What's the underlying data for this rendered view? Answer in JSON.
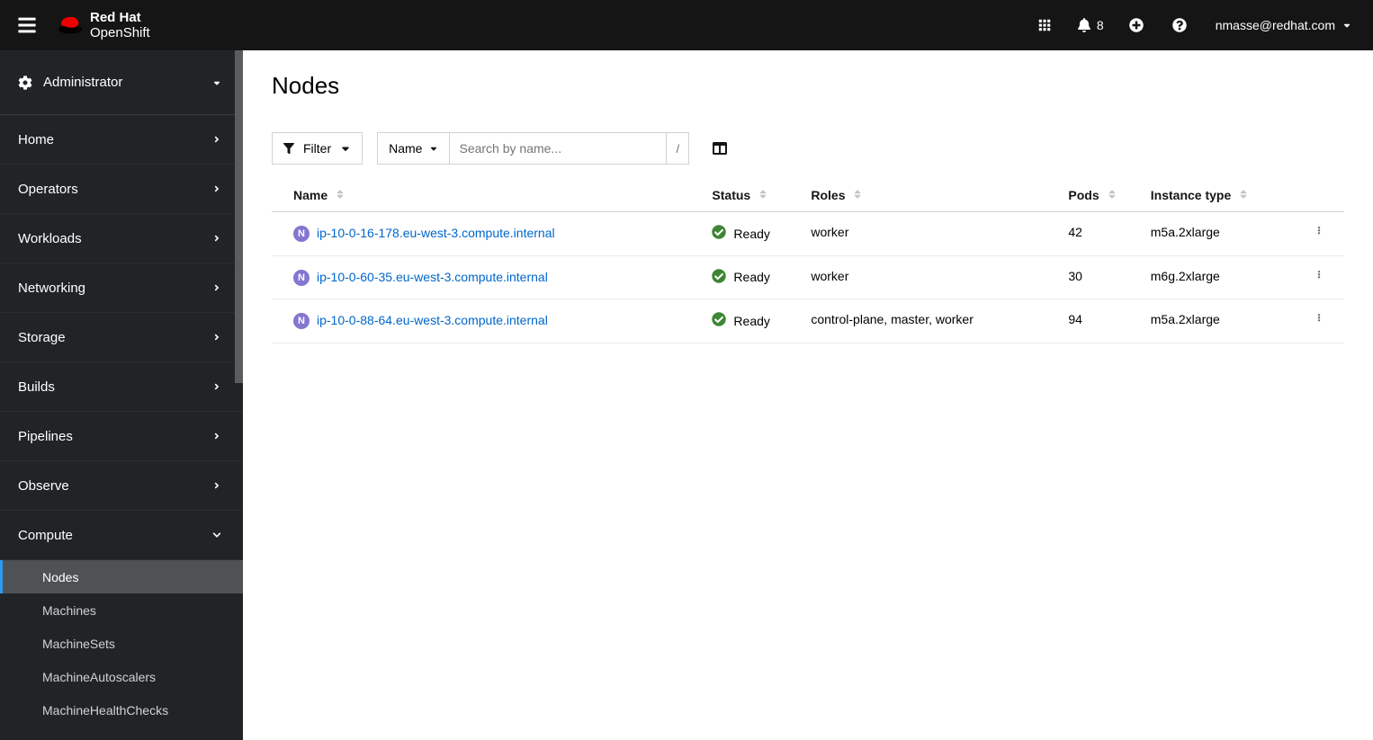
{
  "header": {
    "brand_line1": "Red Hat",
    "brand_line2": "OpenShift",
    "notification_count": "8",
    "user": "nmasse@redhat.com"
  },
  "sidebar": {
    "perspective": "Administrator",
    "items": [
      {
        "label": "Home",
        "expanded": false
      },
      {
        "label": "Operators",
        "expanded": false
      },
      {
        "label": "Workloads",
        "expanded": false
      },
      {
        "label": "Networking",
        "expanded": false
      },
      {
        "label": "Storage",
        "expanded": false
      },
      {
        "label": "Builds",
        "expanded": false
      },
      {
        "label": "Pipelines",
        "expanded": false
      },
      {
        "label": "Observe",
        "expanded": false
      },
      {
        "label": "Compute",
        "expanded": true,
        "subitems": [
          {
            "label": "Nodes",
            "active": true
          },
          {
            "label": "Machines",
            "active": false
          },
          {
            "label": "MachineSets",
            "active": false
          },
          {
            "label": "MachineAutoscalers",
            "active": false
          },
          {
            "label": "MachineHealthChecks",
            "active": false
          }
        ]
      }
    ]
  },
  "main": {
    "title": "Nodes",
    "filter_label": "Filter",
    "search_type": "Name",
    "search_placeholder": "Search by name...",
    "search_hint": "/",
    "columns": [
      "Name",
      "Status",
      "Roles",
      "Pods",
      "Instance type"
    ],
    "status_ready_label": "Ready",
    "node_badge": "N",
    "rows": [
      {
        "name": "ip-10-0-16-178.eu-west-3.compute.internal",
        "status": "Ready",
        "roles": "worker",
        "pods": "42",
        "instance_type": "m5a.2xlarge"
      },
      {
        "name": "ip-10-0-60-35.eu-west-3.compute.internal",
        "status": "Ready",
        "roles": "worker",
        "pods": "30",
        "instance_type": "m6g.2xlarge"
      },
      {
        "name": "ip-10-0-88-64.eu-west-3.compute.internal",
        "status": "Ready",
        "roles": "control-plane, master, worker",
        "pods": "94",
        "instance_type": "m5a.2xlarge"
      }
    ]
  }
}
